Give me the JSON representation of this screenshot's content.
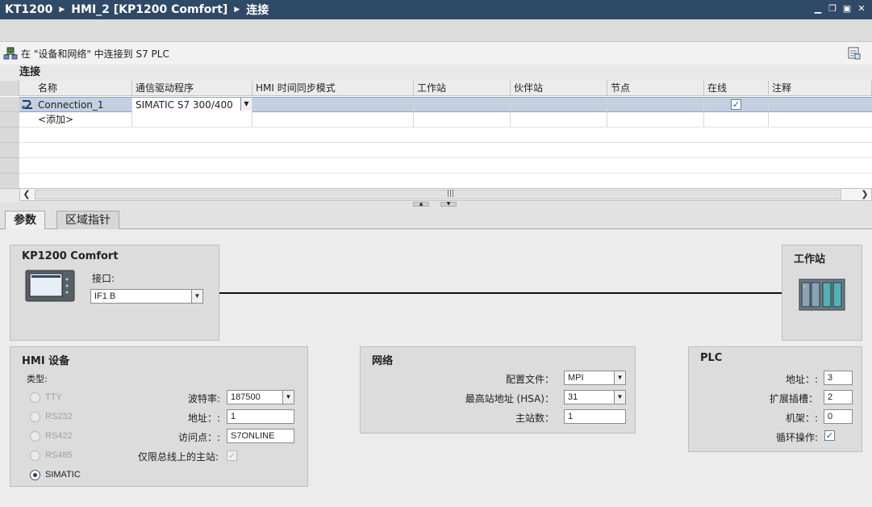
{
  "title": {
    "crumbs": [
      "KT1200",
      "HMI_2 [KP1200 Comfort]",
      "连接"
    ]
  },
  "header": {
    "message": "在 \"设备和网络\" 中连接到 S7 PLC"
  },
  "section": {
    "title": "连接"
  },
  "table": {
    "columns": [
      "名称",
      "通信驱动程序",
      "HMI 时间同步模式",
      "工作站",
      "伙伴站",
      "节点",
      "在线",
      "注释"
    ],
    "rows": [
      {
        "name": "Connection_1",
        "driver": "SIMATIC S7 300/400",
        "sync": "",
        "station": "",
        "partner": "",
        "node": "",
        "online": true,
        "comment": ""
      },
      {
        "name": "<添加>"
      }
    ]
  },
  "tabs": [
    "参数",
    "区域指针"
  ],
  "device": {
    "title": "KP1200 Comfort",
    "interface_label": "接口:",
    "interface_value": "IF1 B"
  },
  "station": {
    "title": "工作站"
  },
  "hmi": {
    "title": "HMI 设备",
    "type_label": "类型:",
    "types": [
      "TTY",
      "RS232",
      "RS422",
      "RS485",
      "SIMATIC"
    ],
    "selected_type": "SIMATIC",
    "baud_label": "波特率:",
    "baud_value": "187500",
    "address_label": "地址：:",
    "address_value": "1",
    "access_label": "访问点：:",
    "access_value": "S7ONLINE",
    "only_master_label": "仅限总线上的主站:",
    "only_master_checked": true
  },
  "network": {
    "title": "网络",
    "profile_label": "配置文件：",
    "profile_value": "MPI",
    "hsa_label": "最高站地址 (HSA)：",
    "hsa_value": "31",
    "masters_label": "主站数：",
    "masters_value": "1"
  },
  "plc": {
    "title": "PLC",
    "address_label": "地址：:",
    "address_value": "3",
    "slot_label": "扩展插槽：",
    "slot_value": "2",
    "rack_label": "机架：:",
    "rack_value": "0",
    "cyclic_label": "循环操作:",
    "cyclic_checked": true
  },
  "colors": {
    "titlebar": "#2e4a66",
    "selection": "#c4cfe1",
    "check": "#1d4f9c"
  }
}
